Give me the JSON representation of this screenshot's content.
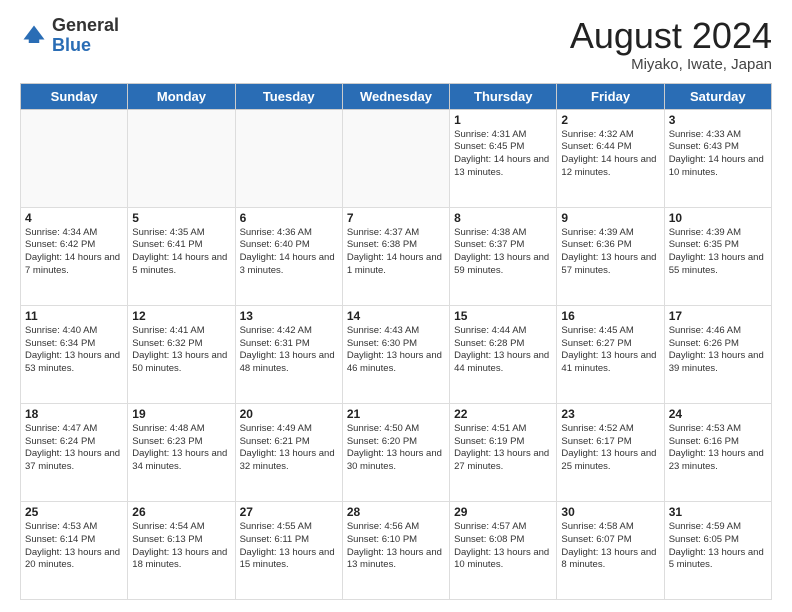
{
  "header": {
    "logo_general": "General",
    "logo_blue": "Blue",
    "month_year": "August 2024",
    "location": "Miyako, Iwate, Japan"
  },
  "weekdays": [
    "Sunday",
    "Monday",
    "Tuesday",
    "Wednesday",
    "Thursday",
    "Friday",
    "Saturday"
  ],
  "weeks": [
    [
      {
        "day": "",
        "info": ""
      },
      {
        "day": "",
        "info": ""
      },
      {
        "day": "",
        "info": ""
      },
      {
        "day": "",
        "info": ""
      },
      {
        "day": "1",
        "info": "Sunrise: 4:31 AM\nSunset: 6:45 PM\nDaylight: 14 hours\nand 13 minutes."
      },
      {
        "day": "2",
        "info": "Sunrise: 4:32 AM\nSunset: 6:44 PM\nDaylight: 14 hours\nand 12 minutes."
      },
      {
        "day": "3",
        "info": "Sunrise: 4:33 AM\nSunset: 6:43 PM\nDaylight: 14 hours\nand 10 minutes."
      }
    ],
    [
      {
        "day": "4",
        "info": "Sunrise: 4:34 AM\nSunset: 6:42 PM\nDaylight: 14 hours\nand 7 minutes."
      },
      {
        "day": "5",
        "info": "Sunrise: 4:35 AM\nSunset: 6:41 PM\nDaylight: 14 hours\nand 5 minutes."
      },
      {
        "day": "6",
        "info": "Sunrise: 4:36 AM\nSunset: 6:40 PM\nDaylight: 14 hours\nand 3 minutes."
      },
      {
        "day": "7",
        "info": "Sunrise: 4:37 AM\nSunset: 6:38 PM\nDaylight: 14 hours\nand 1 minute."
      },
      {
        "day": "8",
        "info": "Sunrise: 4:38 AM\nSunset: 6:37 PM\nDaylight: 13 hours\nand 59 minutes."
      },
      {
        "day": "9",
        "info": "Sunrise: 4:39 AM\nSunset: 6:36 PM\nDaylight: 13 hours\nand 57 minutes."
      },
      {
        "day": "10",
        "info": "Sunrise: 4:39 AM\nSunset: 6:35 PM\nDaylight: 13 hours\nand 55 minutes."
      }
    ],
    [
      {
        "day": "11",
        "info": "Sunrise: 4:40 AM\nSunset: 6:34 PM\nDaylight: 13 hours\nand 53 minutes."
      },
      {
        "day": "12",
        "info": "Sunrise: 4:41 AM\nSunset: 6:32 PM\nDaylight: 13 hours\nand 50 minutes."
      },
      {
        "day": "13",
        "info": "Sunrise: 4:42 AM\nSunset: 6:31 PM\nDaylight: 13 hours\nand 48 minutes."
      },
      {
        "day": "14",
        "info": "Sunrise: 4:43 AM\nSunset: 6:30 PM\nDaylight: 13 hours\nand 46 minutes."
      },
      {
        "day": "15",
        "info": "Sunrise: 4:44 AM\nSunset: 6:28 PM\nDaylight: 13 hours\nand 44 minutes."
      },
      {
        "day": "16",
        "info": "Sunrise: 4:45 AM\nSunset: 6:27 PM\nDaylight: 13 hours\nand 41 minutes."
      },
      {
        "day": "17",
        "info": "Sunrise: 4:46 AM\nSunset: 6:26 PM\nDaylight: 13 hours\nand 39 minutes."
      }
    ],
    [
      {
        "day": "18",
        "info": "Sunrise: 4:47 AM\nSunset: 6:24 PM\nDaylight: 13 hours\nand 37 minutes."
      },
      {
        "day": "19",
        "info": "Sunrise: 4:48 AM\nSunset: 6:23 PM\nDaylight: 13 hours\nand 34 minutes."
      },
      {
        "day": "20",
        "info": "Sunrise: 4:49 AM\nSunset: 6:21 PM\nDaylight: 13 hours\nand 32 minutes."
      },
      {
        "day": "21",
        "info": "Sunrise: 4:50 AM\nSunset: 6:20 PM\nDaylight: 13 hours\nand 30 minutes."
      },
      {
        "day": "22",
        "info": "Sunrise: 4:51 AM\nSunset: 6:19 PM\nDaylight: 13 hours\nand 27 minutes."
      },
      {
        "day": "23",
        "info": "Sunrise: 4:52 AM\nSunset: 6:17 PM\nDaylight: 13 hours\nand 25 minutes."
      },
      {
        "day": "24",
        "info": "Sunrise: 4:53 AM\nSunset: 6:16 PM\nDaylight: 13 hours\nand 23 minutes."
      }
    ],
    [
      {
        "day": "25",
        "info": "Sunrise: 4:53 AM\nSunset: 6:14 PM\nDaylight: 13 hours\nand 20 minutes."
      },
      {
        "day": "26",
        "info": "Sunrise: 4:54 AM\nSunset: 6:13 PM\nDaylight: 13 hours\nand 18 minutes."
      },
      {
        "day": "27",
        "info": "Sunrise: 4:55 AM\nSunset: 6:11 PM\nDaylight: 13 hours\nand 15 minutes."
      },
      {
        "day": "28",
        "info": "Sunrise: 4:56 AM\nSunset: 6:10 PM\nDaylight: 13 hours\nand 13 minutes."
      },
      {
        "day": "29",
        "info": "Sunrise: 4:57 AM\nSunset: 6:08 PM\nDaylight: 13 hours\nand 10 minutes."
      },
      {
        "day": "30",
        "info": "Sunrise: 4:58 AM\nSunset: 6:07 PM\nDaylight: 13 hours\nand 8 minutes."
      },
      {
        "day": "31",
        "info": "Sunrise: 4:59 AM\nSunset: 6:05 PM\nDaylight: 13 hours\nand 5 minutes."
      }
    ]
  ]
}
